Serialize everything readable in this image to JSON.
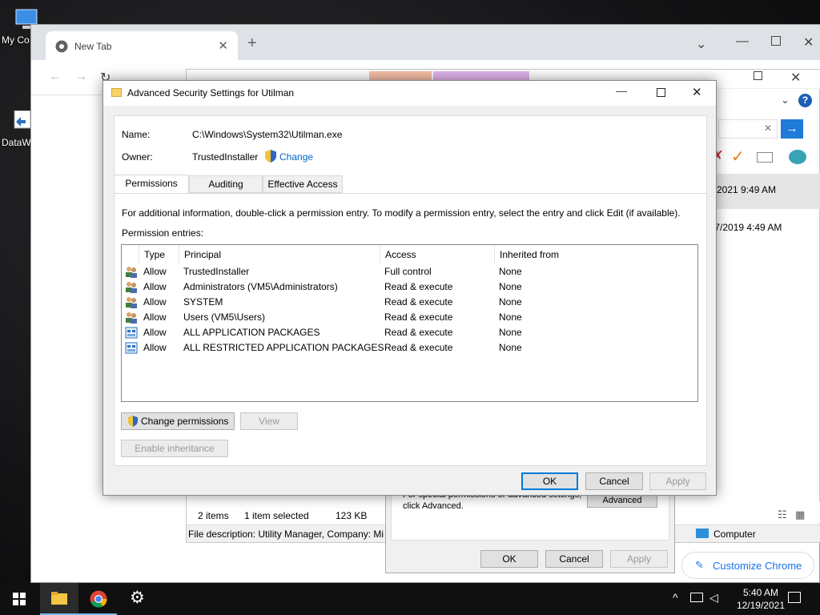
{
  "desktop": {
    "icons": [
      {
        "label": "My Co"
      },
      {
        "label": "DataW"
      }
    ]
  },
  "chrome": {
    "tab_title": "New Tab",
    "customize_label": "Customize Chrome"
  },
  "explorer": {
    "item_count": "2 items",
    "selected": "1 item selected",
    "size": "123 KB",
    "file_description": "File description: Utility Manager, Company: Mi",
    "computer_label": "Computer",
    "date1": "2021 9:49 AM",
    "date2": "/7/2019 4:49 AM"
  },
  "props_dialog": {
    "text_line1": "For special permissions or advanced settings,",
    "text_line2": "click Advanced.",
    "advanced_label": "Advanced",
    "ok_label": "OK",
    "cancel_label": "Cancel",
    "apply_label": "Apply"
  },
  "dialog": {
    "title": "Advanced Security Settings for Utilman",
    "name_label": "Name:",
    "name_value": "C:\\Windows\\System32\\Utilman.exe",
    "owner_label": "Owner:",
    "owner_value": "TrustedInstaller",
    "change_link": "Change",
    "tabs": [
      {
        "label": "Permissions",
        "active": true
      },
      {
        "label": "Auditing",
        "active": false
      },
      {
        "label": "Effective Access",
        "active": false
      }
    ],
    "info_text": "For additional information, double-click a permission entry. To modify a permission entry, select the entry and click Edit (if available).",
    "entries_label": "Permission entries:",
    "columns": {
      "type": "Type",
      "principal": "Principal",
      "access": "Access",
      "inherited": "Inherited from"
    },
    "rows": [
      {
        "icon": "users-icon",
        "type": "Allow",
        "principal": "TrustedInstaller",
        "access": "Full control",
        "inherited": "None"
      },
      {
        "icon": "users-icon",
        "type": "Allow",
        "principal": "Administrators (VM5\\Administrators)",
        "access": "Read & execute",
        "inherited": "None"
      },
      {
        "icon": "users-icon",
        "type": "Allow",
        "principal": "SYSTEM",
        "access": "Read & execute",
        "inherited": "None"
      },
      {
        "icon": "users-icon",
        "type": "Allow",
        "principal": "Users (VM5\\Users)",
        "access": "Read & execute",
        "inherited": "None"
      },
      {
        "icon": "package-icon",
        "type": "Allow",
        "principal": "ALL APPLICATION PACKAGES",
        "access": "Read & execute",
        "inherited": "None"
      },
      {
        "icon": "package-icon",
        "type": "Allow",
        "principal": "ALL RESTRICTED APPLICATION PACKAGES",
        "access": "Read & execute",
        "inherited": "None"
      }
    ],
    "change_permissions_label": "Change permissions",
    "view_label": "View",
    "enable_inheritance_label": "Enable inheritance",
    "ok_label": "OK",
    "cancel_label": "Cancel",
    "apply_label": "Apply"
  },
  "taskbar": {
    "time": "5:40 AM",
    "date": "12/19/2021"
  },
  "colors": {
    "accent": "#0078d7",
    "link": "#0066cc",
    "chrome_blue": "#1a73e8"
  }
}
